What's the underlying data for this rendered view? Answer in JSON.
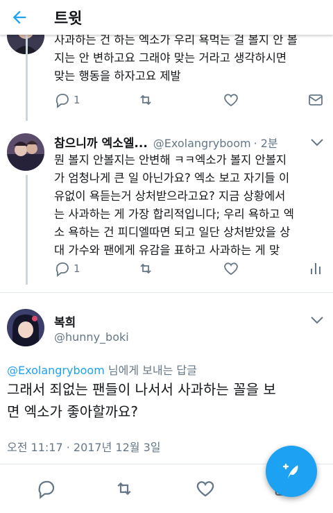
{
  "header": {
    "title": "트윗"
  },
  "tweet1": {
    "lines": [
      "사과하는 건 하는 엑소가 우리 욕먹는 걸 볼지 안 볼",
      "지는 안 변하고요 그래야 맞는 거라고 생각하시면",
      "맞는 행동을 하자고요 제발"
    ],
    "reply_count": "1"
  },
  "tweet2": {
    "name": "참으니까 엑소엘...",
    "handle": "@Exolangryboom",
    "time": "· 2분",
    "lines": [
      "뭔 볼지 안볼지는 안변해 ㅋㅋ엑소가 볼지 안볼지",
      "가 엄청나게 큰 일 아닌가요? 엑소 보고 자기들 이",
      "유없이 욕듣는거  상처받으라고요? 지금 상황에서",
      "는 사과하는 게 가장 합리적입니다; 우리 욕하고 엑",
      "소 욕하는 건 피디엘따면 되고 일단 상처받았을 상",
      "대 가수와 팬에게 유감을 표하고 사과하는 게 맞"
    ],
    "reply_count": "1"
  },
  "main_tweet": {
    "name": "복희",
    "handle": "@hunny_boki",
    "reply_to_handle": "@Exolangryboom",
    "reply_to_suffix": " 님에게 보내는 답글",
    "lines": [
      "그래서 죄없는 팬들이 나서서 사과하는 꼴을 보",
      "면 엑소가 좋아할까요?"
    ],
    "timestamp": "오전 11:17 · 2017년 12월 3일"
  },
  "colors": {
    "accent": "#1da1f2",
    "secondary_text": "#657786",
    "primary_text": "#14171a"
  },
  "icons": [
    "back-arrow-icon",
    "reply-icon",
    "retweet-icon",
    "like-icon",
    "message-icon",
    "analytics-icon",
    "chevron-down-icon",
    "compose-tweet-icon"
  ]
}
